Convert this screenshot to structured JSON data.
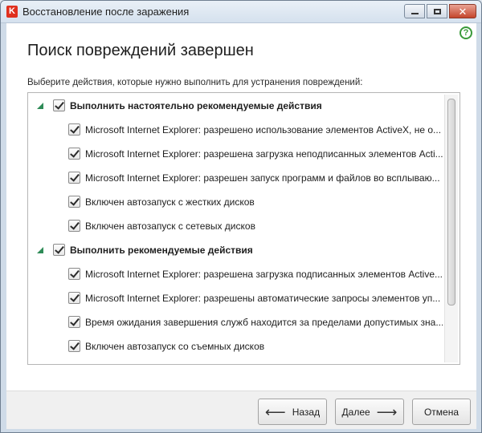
{
  "window": {
    "title": "Восстановление после заражения",
    "app_icon_letter": "K"
  },
  "page": {
    "heading": "Поиск повреждений завершен",
    "instruction": "Выберите действия, которые нужно выполнить для устранения повреждений:",
    "help_symbol": "?"
  },
  "groups": [
    {
      "label": "Выполнить настоятельно рекомендуемые действия",
      "checked": true,
      "expanded": true,
      "items": [
        {
          "label": "Microsoft Internet Explorer: разрешено использование элементов ActiveX, не о...",
          "checked": true
        },
        {
          "label": "Microsoft Internet Explorer: разрешена загрузка неподписанных элементов Acti...",
          "checked": true
        },
        {
          "label": "Microsoft Internet Explorer: разрешен запуск программ и файлов во всплываю...",
          "checked": true
        },
        {
          "label": "Включен автозапуск с жестких дисков",
          "checked": true
        },
        {
          "label": "Включен автозапуск с сетевых дисков",
          "checked": true
        }
      ]
    },
    {
      "label": "Выполнить рекомендуемые действия",
      "checked": true,
      "expanded": true,
      "items": [
        {
          "label": "Microsoft Internet Explorer: разрешена загрузка подписанных элементов Active...",
          "checked": true
        },
        {
          "label": "Microsoft Internet Explorer: разрешены автоматические запросы элементов уп...",
          "checked": true
        },
        {
          "label": "Время ожидания завершения служб находится за пределами допустимых зна...",
          "checked": true
        },
        {
          "label": "Включен автозапуск со съемных дисков",
          "checked": true
        }
      ]
    }
  ],
  "buttons": {
    "back": "Назад",
    "next": "Далее",
    "cancel": "Отмена",
    "back_arrow": "⟵",
    "next_arrow": "⟶"
  },
  "icons": {
    "app": "kaspersky-logo-icon",
    "help": "help-icon",
    "minimize": "minimize-icon",
    "maximize": "maximize-icon",
    "close": "close-icon",
    "expand": "expand-triangle-icon"
  },
  "colors": {
    "accent_green": "#2e8b57",
    "brand_red": "#e0301e",
    "help_green": "#3a9a3a"
  }
}
